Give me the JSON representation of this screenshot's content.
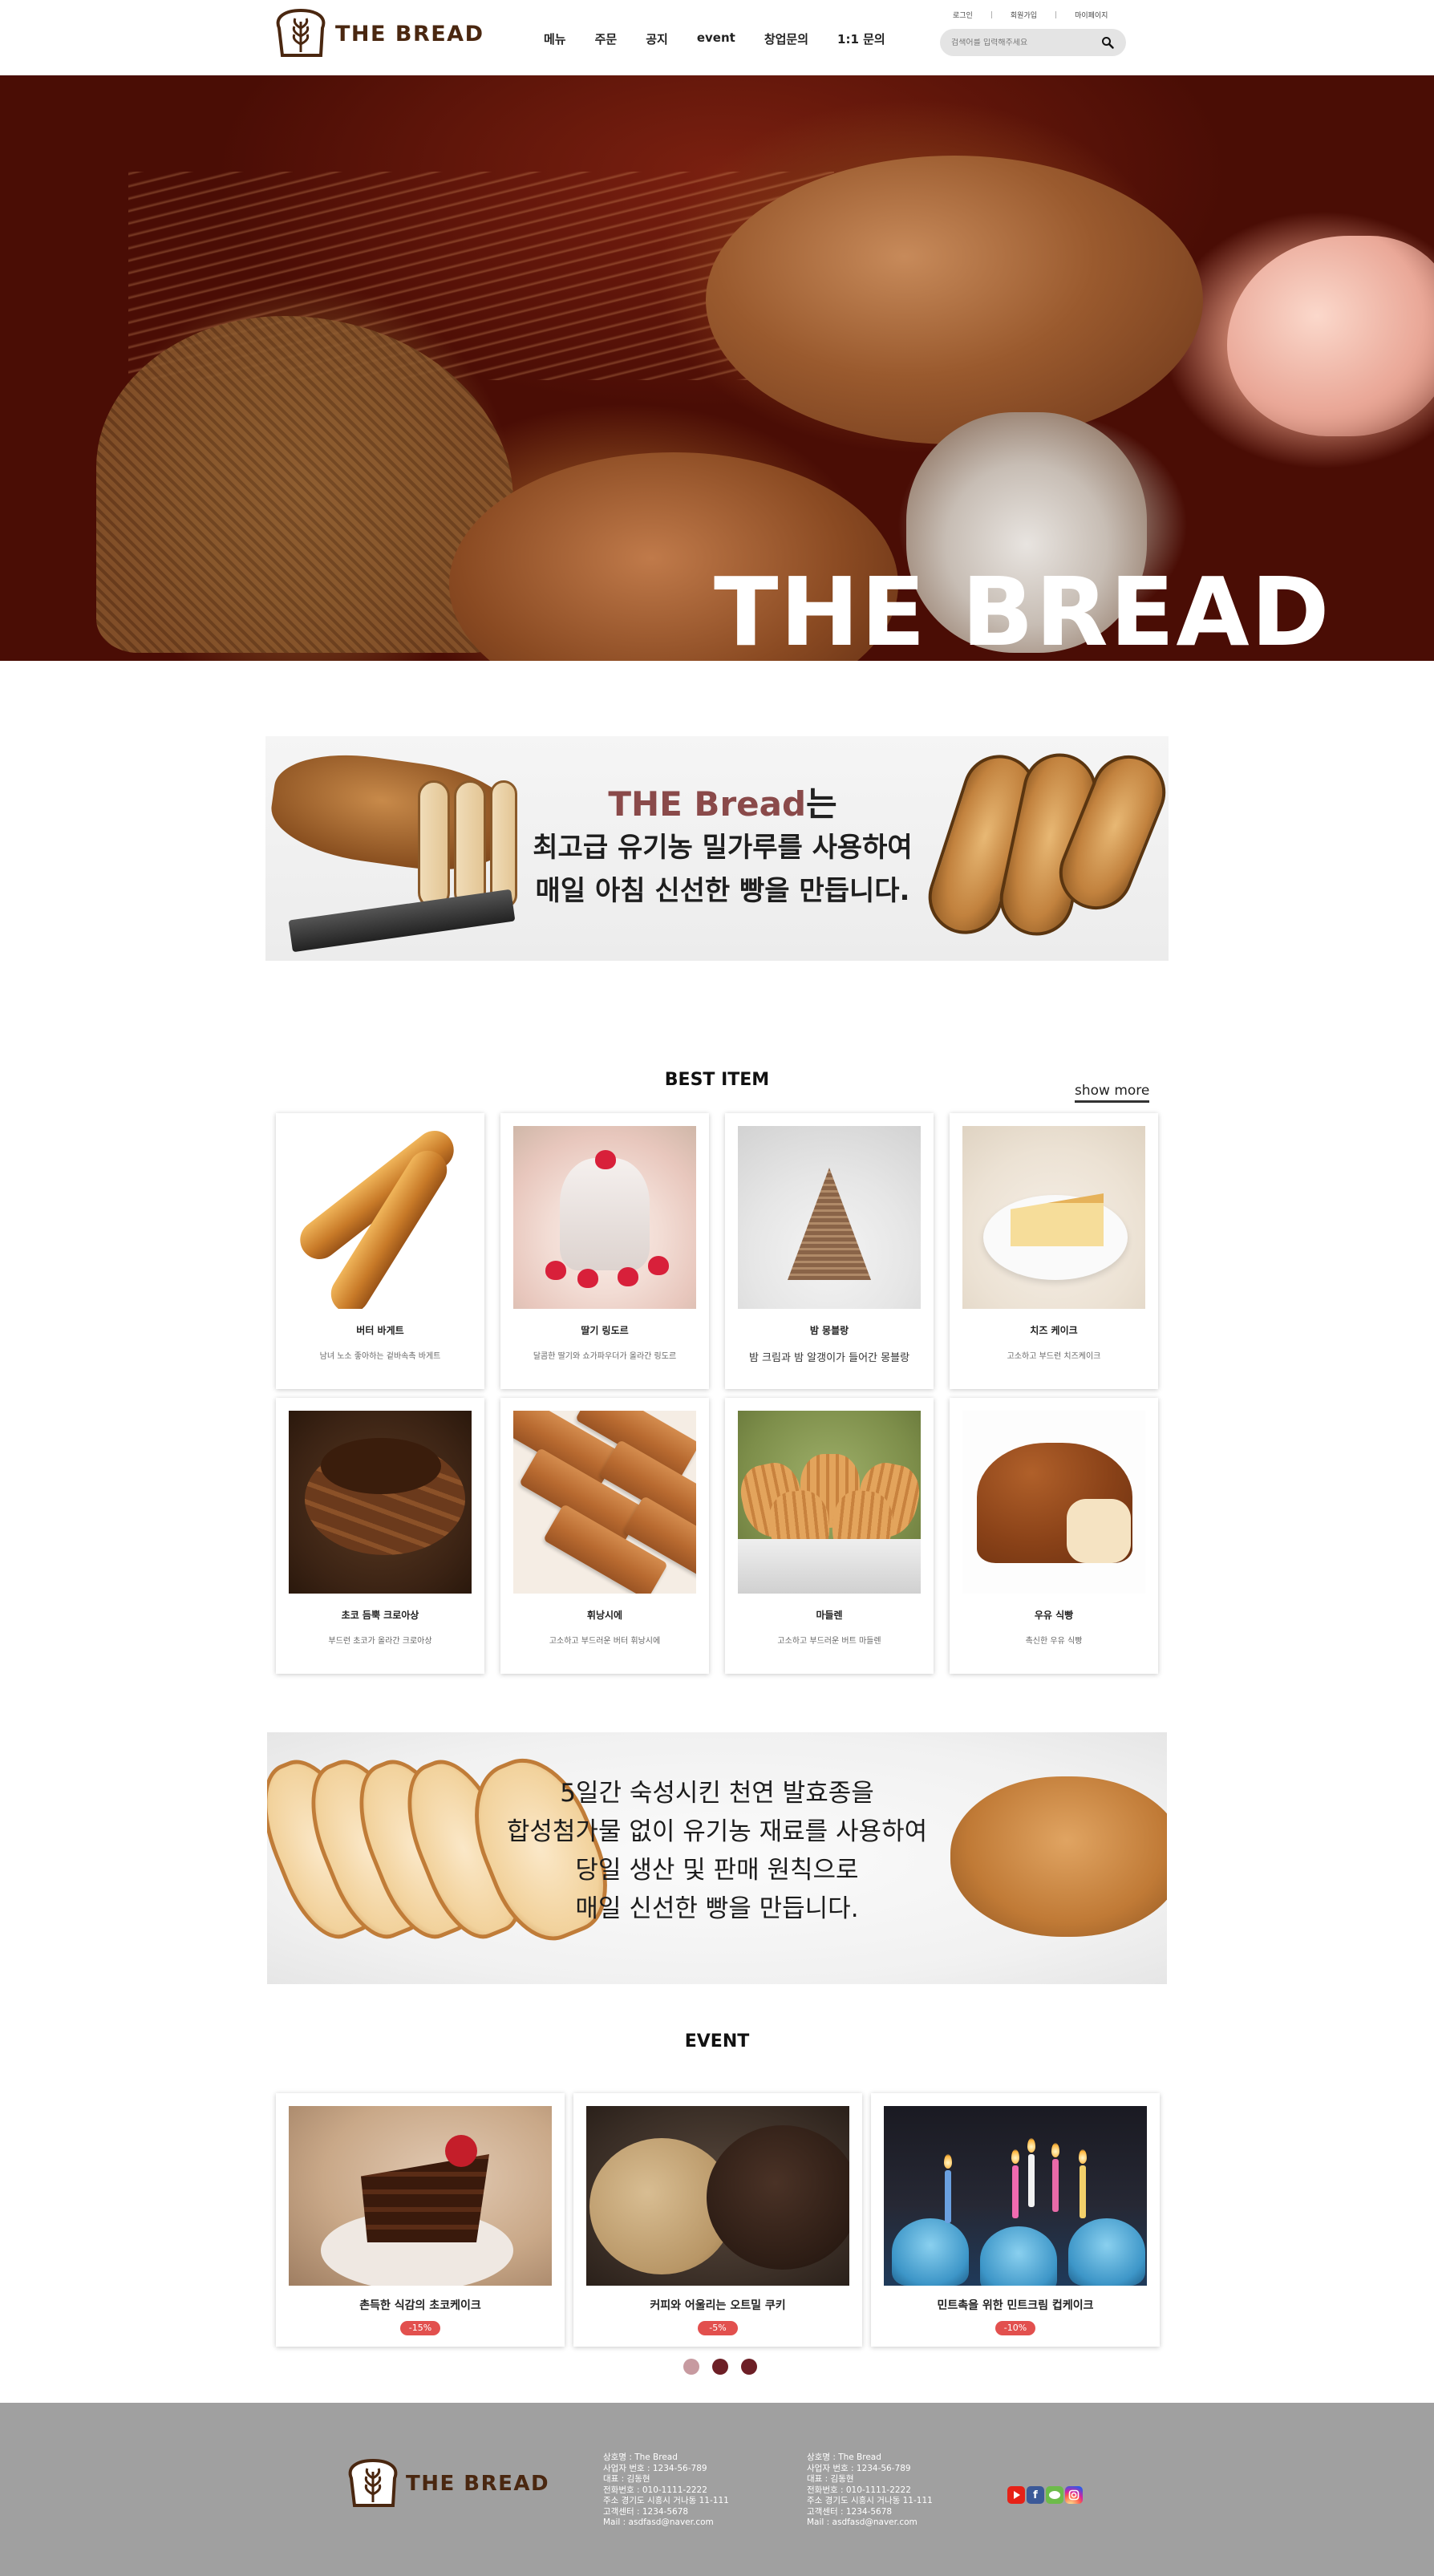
{
  "brand": {
    "name": "THE BREAD",
    "color": "#4a2710"
  },
  "header": {
    "nav": [
      "메뉴",
      "주문",
      "공지",
      "event",
      "창업문의",
      "1:1 문의"
    ],
    "util": [
      "로그인",
      "회원가입",
      "마이페이지"
    ],
    "search": {
      "placeholder": "검색어를 입력해주세요",
      "icon": "search-icon"
    }
  },
  "hero": {
    "title": "THE BREAD"
  },
  "banner1": {
    "brand": "THE Bread",
    "brand_suffix": "는",
    "lines": [
      "최고급 유기농 밀가루를 사용하여",
      "매일 아침 신선한 빵을 만듭니다."
    ],
    "accent_color": "#8a4a4a"
  },
  "best": {
    "title": "BEST ITEM",
    "show_more": "show more",
    "items": [
      {
        "name": "버터 바게트",
        "desc": "남녀 노소 좋아하는 겉바속촉 바게트"
      },
      {
        "name": "딸기 링도르",
        "desc": "달콤한 딸기와 쇼가파우더가 올라간 링도르"
      },
      {
        "name": "밤 몽블랑",
        "desc": "밤 크림과 밤 알갱이가 들어간 몽블랑"
      },
      {
        "name": "치즈 케이크",
        "desc": "고소하고 부드런 치즈케이크"
      },
      {
        "name": "초코 듬뿍 크로아상",
        "desc": "부드런 초코가 올라간 크로아상"
      },
      {
        "name": "휘낭시에",
        "desc": "고소하고 부드러운 버터 휘낭시에"
      },
      {
        "name": "마들렌",
        "desc": "고소하고 부드러운 버트 마들렌"
      },
      {
        "name": "우유 식빵",
        "desc": "촉신한 우유 식빵"
      }
    ]
  },
  "banner2": {
    "lines": [
      "5일간 숙성시킨 천연 발효종을",
      "합성첨가물 없이 유기농 재료를 사용하여",
      "당일 생산 및 판매 원칙으로",
      "매일 신선한 빵을 만듭니다."
    ]
  },
  "event": {
    "title": "EVENT",
    "items": [
      {
        "name": "촌득한 식감의 초코케이크",
        "discount": "-15%"
      },
      {
        "name": "커피와 어울리는 오트밀 쿠키",
        "discount": "-5%"
      },
      {
        "name": "민트촉을 위한 민트크림 컵케이크",
        "discount": "-10%"
      }
    ],
    "pagination": {
      "pages": 3,
      "active": 2,
      "active_color": "#6d1f26",
      "inactive_color": "#c79aa0"
    },
    "badge_color": "#e2504e"
  },
  "footer": {
    "background": "#a0a0a0",
    "columns": [
      [
        "상호명 : The Bread",
        "사업자 번호 : 1234-56-789",
        "대표 : 김동현",
        "전화번호 : 010-1111-2222",
        "주소 경기도 시흥시 거나동 11-111",
        "고객센터 : 1234-5678",
        "Mail : asdfasd@naver.com"
      ],
      [
        "상호명 : The Bread",
        "사업자 번호 : 1234-56-789",
        "대표 : 김동현",
        "전화번호 : 010-1111-2222",
        "주소 경기도 시흥시 거나동 11-111",
        "고객센터 : 1234-5678",
        "Mail : asdfasd@naver.com"
      ]
    ],
    "sns": [
      {
        "icon": "youtube-icon",
        "color": "#e62117"
      },
      {
        "icon": "facebook-icon",
        "color": "#3b5998"
      },
      {
        "icon": "kakaotalk-icon",
        "color": "#6dbb4a"
      },
      {
        "icon": "instagram-icon",
        "color": "#d6249f"
      }
    ]
  }
}
